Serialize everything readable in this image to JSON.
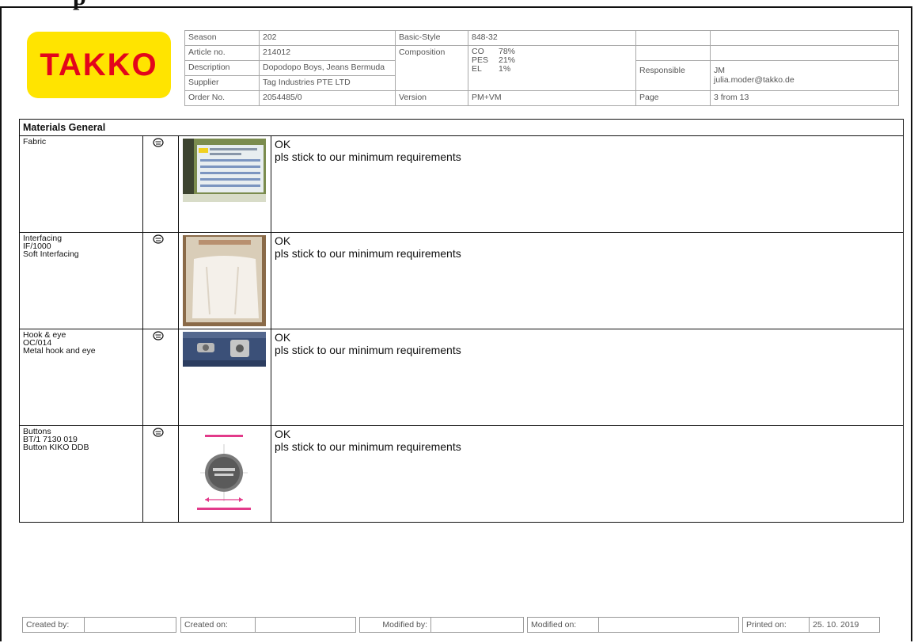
{
  "page_heading": "p",
  "logo_text": "TAKKO",
  "header": {
    "season_label": "Season",
    "season": "202",
    "basic_style_label": "Basic-Style",
    "basic_style": "848-32",
    "article_label": "Article no.",
    "article": "214012",
    "composition_label": "Composition",
    "composition": [
      {
        "fiber": "CO",
        "pct": "78%"
      },
      {
        "fiber": "PES",
        "pct": "21%"
      },
      {
        "fiber": "EL",
        "pct": "1%"
      }
    ],
    "description_label": "Description",
    "description": "Dopodopo Boys, Jeans Bermuda",
    "supplier_label": "Supplier",
    "supplier": "Tag Industries PTE LTD",
    "responsible_label": "Responsible",
    "responsible_initials": "JM",
    "responsible_email": "julia.moder@takko.de",
    "order_label": "Order No.",
    "order": "2054485/0",
    "version_label": "Version",
    "version": "PM+VM",
    "page_label": "Page",
    "page": "3 from 13"
  },
  "materials": {
    "title": "Materials General",
    "rows": [
      {
        "lines": [
          "Fabric"
        ],
        "status": "OK",
        "comment": "pls stick to our minimum requirements"
      },
      {
        "lines": [
          "Interfacing",
          "IF/1000",
          "Soft Interfacing"
        ],
        "status": "OK",
        "comment": "pls stick to our minimum requirements"
      },
      {
        "lines": [
          "Hook & eye",
          "OC/014",
          "Metal hook and eye"
        ],
        "status": "OK",
        "comment": "pls stick to our minimum requirements"
      },
      {
        "lines": [
          "Buttons",
          "BT/1  7130 019",
          "Button KIKO DDB"
        ],
        "status": "OK",
        "comment": "pls stick to our minimum requirements"
      }
    ]
  },
  "footer": {
    "created_by_label": "Created by:",
    "created_on_label": "Created on:",
    "modified_by_label": "Modified by:",
    "modified_on_label": "Modified on:",
    "printed_on_label": "Printed on:",
    "printed_on": "25. 10. 2019"
  }
}
